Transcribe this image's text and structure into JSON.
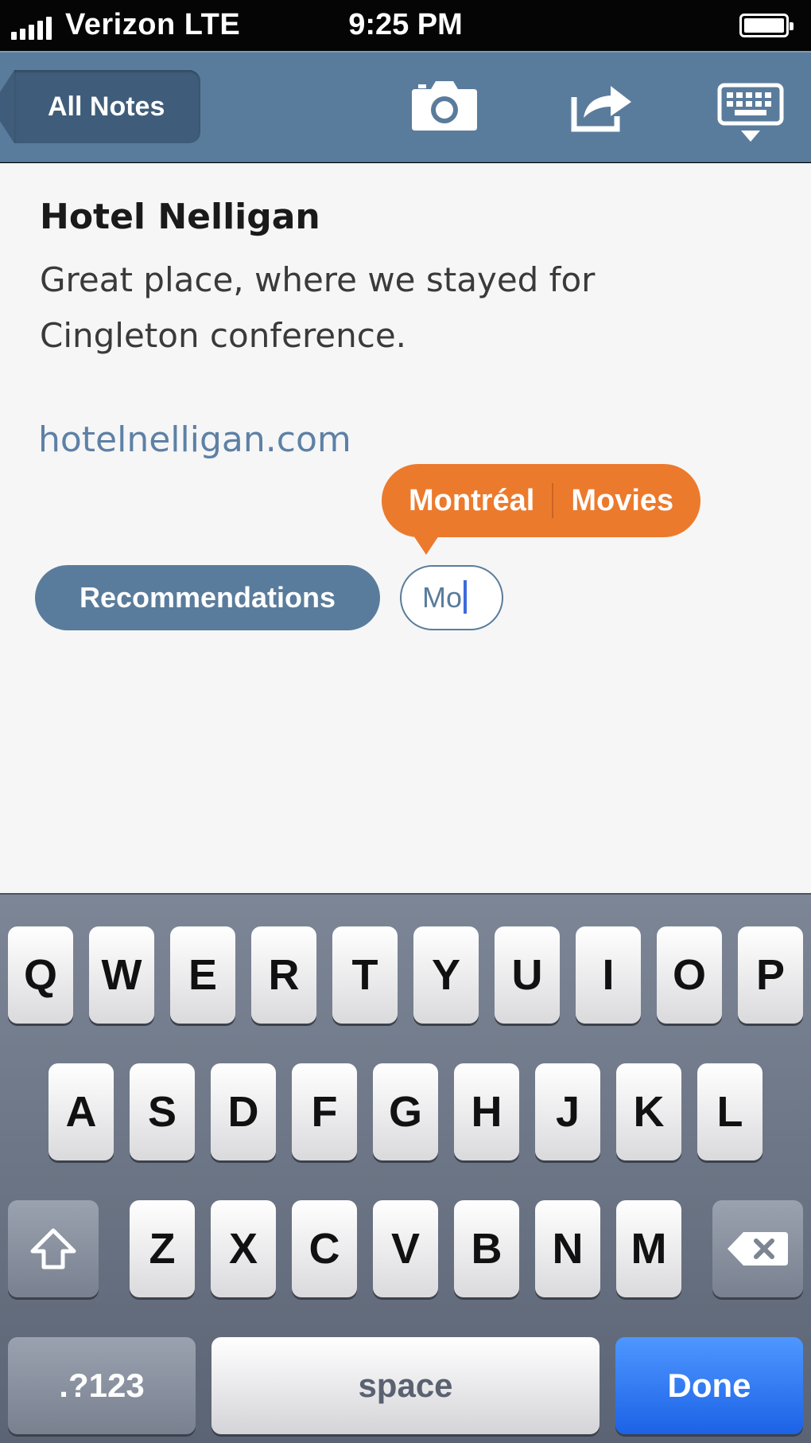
{
  "status_bar": {
    "carrier": "Verizon  LTE",
    "time": "9:25 PM",
    "signal_bars": 5,
    "battery_level": 1.0
  },
  "nav_bar": {
    "back_label": "All Notes",
    "icons": [
      "camera-icon",
      "share-icon",
      "keyboard-hide-icon"
    ],
    "accent_color": "#5a7c9c"
  },
  "note": {
    "title": "Hotel Nelligan",
    "body": "Great place, where we stayed for Cingleton conference.",
    "link": "hotelnelligan.com"
  },
  "tags": {
    "suggestions": [
      "Montréal",
      "Movies"
    ],
    "existing": [
      "Recommendations"
    ],
    "input_value": "Mo",
    "suggestion_color": "#ec7a2c"
  },
  "keyboard": {
    "row1": [
      "Q",
      "W",
      "E",
      "R",
      "T",
      "Y",
      "U",
      "I",
      "O",
      "P"
    ],
    "row2": [
      "A",
      "S",
      "D",
      "F",
      "G",
      "H",
      "J",
      "K",
      "L"
    ],
    "row3": [
      "Z",
      "X",
      "C",
      "V",
      "B",
      "N",
      "M"
    ],
    "symbols_label": ".?123",
    "space_label": "space",
    "done_label": "Done",
    "shift_icon": "shift-icon",
    "delete_icon": "delete-icon"
  }
}
